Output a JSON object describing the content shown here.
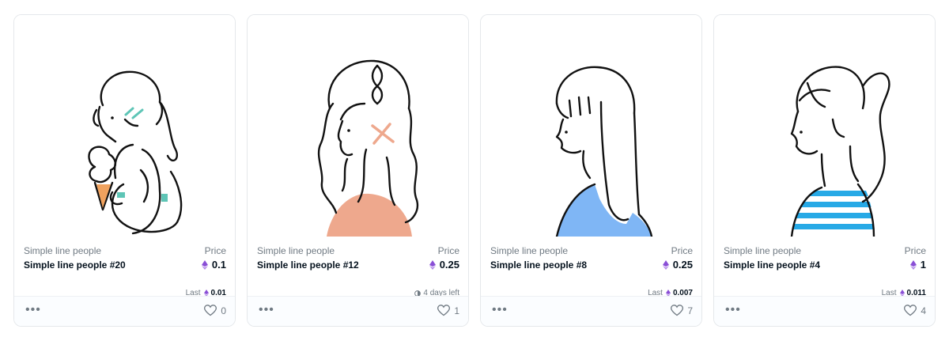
{
  "cards": [
    {
      "collection": "Simple line people",
      "name": "Simple line people #20",
      "price_label": "Price",
      "price": "0.1",
      "sub_type": "last",
      "last_label": "Last",
      "last_price": "0.01",
      "time_left": "",
      "likes": "0",
      "image_icon": "girl-with-ice-cream-illustration",
      "accent_color": "#5ec5b6"
    },
    {
      "collection": "Simple line people",
      "name": "Simple line people #12",
      "price_label": "Price",
      "price": "0.25",
      "sub_type": "time",
      "last_label": "",
      "last_price": "",
      "time_left": "4 days left",
      "likes": "1",
      "image_icon": "girl-with-braid-illustration",
      "accent_color": "#eea88d"
    },
    {
      "collection": "Simple line people",
      "name": "Simple line people #8",
      "price_label": "Price",
      "price": "0.25",
      "sub_type": "last",
      "last_label": "Last",
      "last_price": "0.007",
      "time_left": "",
      "likes": "7",
      "image_icon": "girl-with-bangs-illustration",
      "accent_color": "#7fb6f5"
    },
    {
      "collection": "Simple line people",
      "name": "Simple line people #4",
      "price_label": "Price",
      "price": "1",
      "sub_type": "last",
      "last_label": "Last",
      "last_price": "0.011",
      "time_left": "",
      "likes": "4",
      "image_icon": "girl-with-ponytail-illustration",
      "accent_color": "#27a9e6"
    }
  ],
  "icons": {
    "price": "ethereum-icon",
    "more": "more-options-icon",
    "like": "heart-icon",
    "time": "clock-icon"
  },
  "colors": {
    "eth": "#8a4fd6",
    "text_primary": "#04111d",
    "text_secondary": "#707a83"
  }
}
